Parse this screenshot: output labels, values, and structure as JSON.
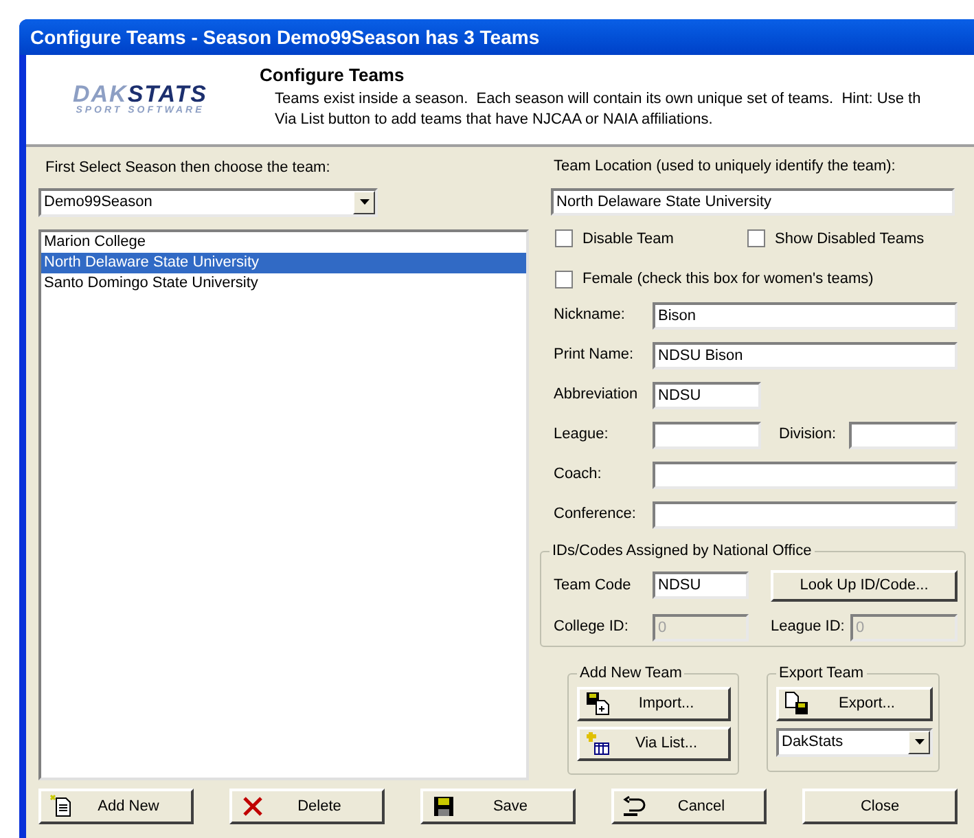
{
  "window": {
    "title": "Configure Teams - Season Demo99Season has 3 Teams"
  },
  "logo": {
    "word_1": "DAK",
    "word_2": "STATS",
    "tagline": "SPORT SOFTWARE"
  },
  "header": {
    "title": "Configure Teams",
    "lines": [
      "Teams exist inside a season.  Each season will contain its own unique set of teams.  Hint: Use th",
      "Via List button to add teams that have NJCAA or NAIA affiliations."
    ]
  },
  "season_picker": {
    "label": "First Select Season then choose the team:",
    "value": "Demo99Season"
  },
  "teams": [
    {
      "label": "Marion College",
      "selected": false
    },
    {
      "label": "North Delaware State University",
      "selected": true
    },
    {
      "label": "Santo Domingo State University",
      "selected": false
    }
  ],
  "team_location": {
    "label": "Team Location (used to uniquely identify the team):",
    "value": "North Delaware State University"
  },
  "checkboxes": [
    {
      "label": "Disable Team",
      "checked": false
    },
    {
      "label": "Show Disabled Teams",
      "checked": false
    },
    {
      "label": "Female (check this box for women's teams)",
      "checked": false
    }
  ],
  "field_rows": [
    {
      "kind": "wide",
      "fields": [
        {
          "label": "Nickname:",
          "value": "Bison"
        }
      ]
    },
    {
      "kind": "wide",
      "fields": [
        {
          "label": "Print Name:",
          "value": "NDSU Bison"
        }
      ]
    },
    {
      "kind": "short",
      "fields": [
        {
          "label": "Abbreviation",
          "value": "NDSU"
        }
      ]
    },
    {
      "kind": "split",
      "fields": [
        {
          "label": "League:"
        },
        {
          "label": "Division:"
        }
      ]
    },
    {
      "kind": "wide",
      "fields": [
        {
          "label": "Coach:"
        }
      ]
    },
    {
      "kind": "wide",
      "fields": [
        {
          "label": "Conference:"
        }
      ]
    }
  ],
  "ids_group": {
    "title": "IDs/Codes Assigned by National Office",
    "team_code": {
      "label": "Team Code",
      "value": "NDSU",
      "disabled": false
    },
    "lookup_button": "Look Up ID/Code...",
    "college_id": {
      "label": "College ID:",
      "value": "0",
      "disabled": true
    },
    "league_id": {
      "label": "League ID:",
      "value": "0",
      "disabled": true
    }
  },
  "add_new_team": {
    "title": "Add New Team",
    "buttons": [
      {
        "label": "Import...",
        "kind": "import"
      },
      {
        "label": "Via List...",
        "kind": "list"
      }
    ]
  },
  "export_team": {
    "title": "Export Team",
    "button": {
      "label": "Export...",
      "kind": "export"
    },
    "format": "DakStats"
  },
  "buttons": [
    {
      "label": "Add New",
      "kind": "add"
    },
    {
      "label": "Delete",
      "kind": "delete"
    },
    {
      "label": "Save",
      "kind": "save"
    },
    {
      "label": "Cancel",
      "kind": "cancel"
    },
    {
      "label": "Close",
      "kind": "plain"
    }
  ]
}
